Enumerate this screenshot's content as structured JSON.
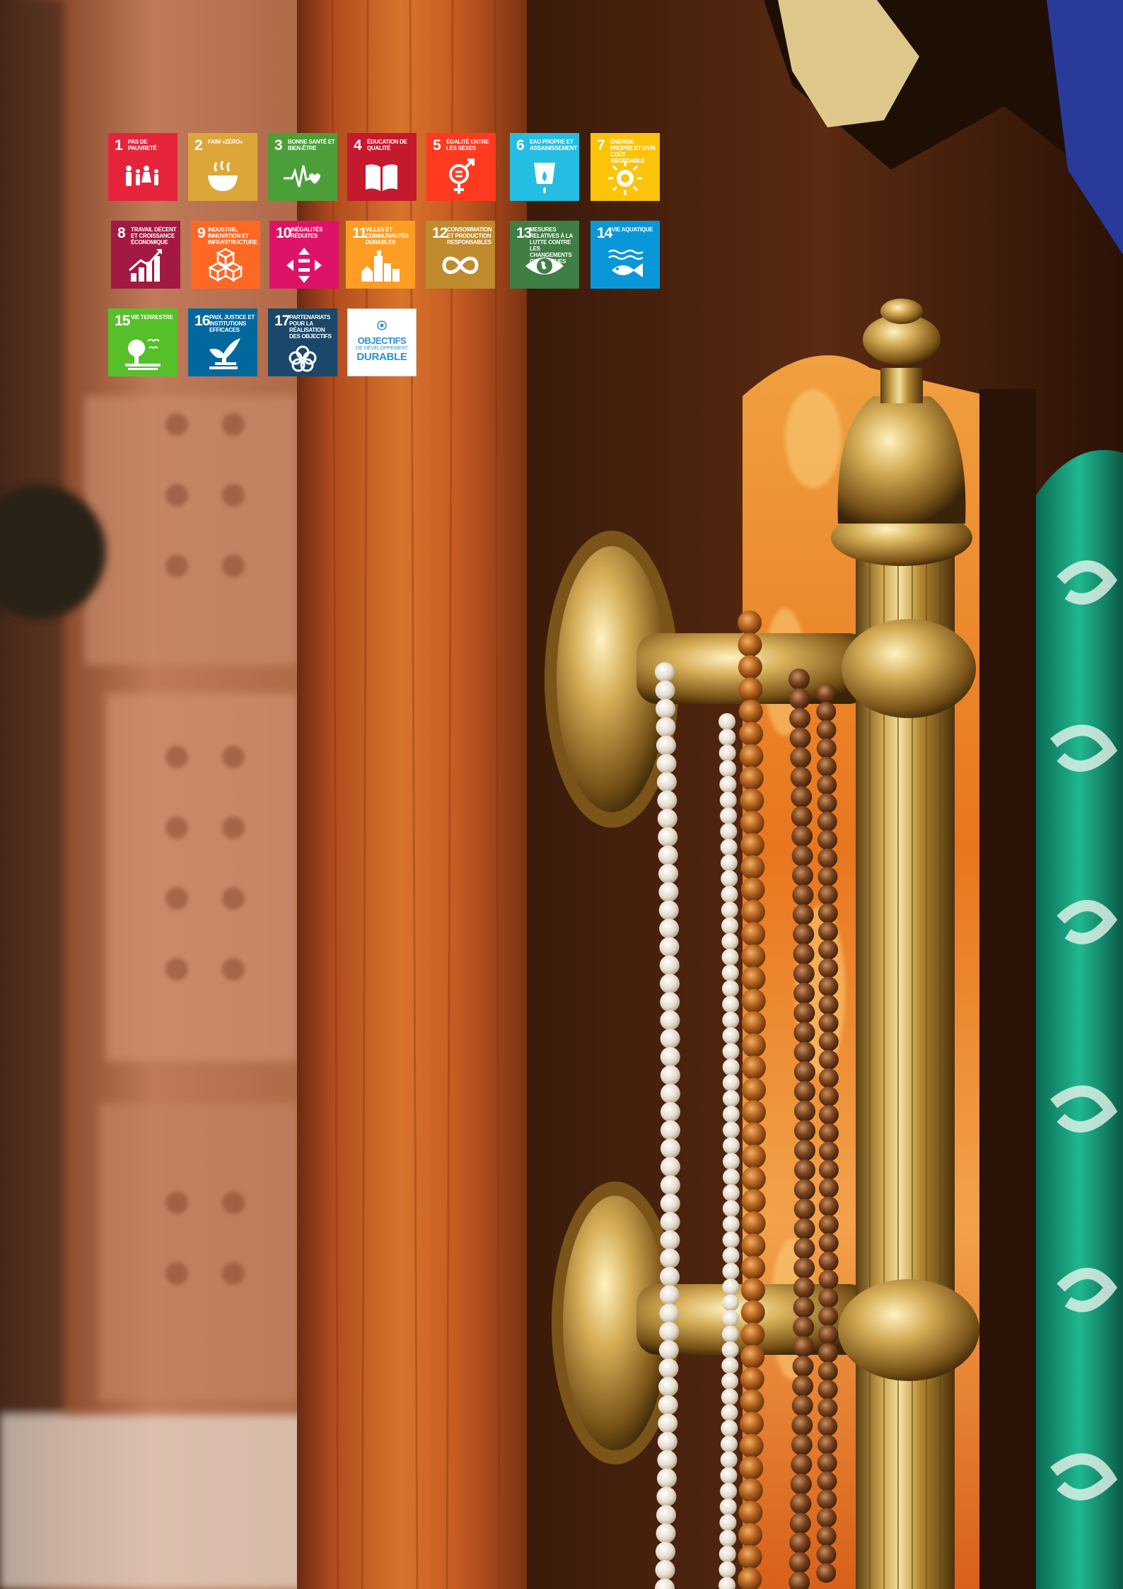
{
  "sdg_goals": [
    {
      "number": "1",
      "label": "PAS DE PAUVRETÉ",
      "color": "#e5243b",
      "icon": "family-icon"
    },
    {
      "number": "2",
      "label": "FAIM «ZÉRO»",
      "color": "#dda63a",
      "icon": "bowl-icon"
    },
    {
      "number": "3",
      "label": "BONNE SANTÉ ET BIEN-ÊTRE",
      "color": "#4c9f38",
      "icon": "heartbeat-icon"
    },
    {
      "number": "4",
      "label": "ÉDUCATION DE QUALITÉ",
      "color": "#c5192d",
      "icon": "book-icon"
    },
    {
      "number": "5",
      "label": "ÉGALITÉ ENTRE LES SEXES",
      "color": "#ff3a21",
      "icon": "gender-equality-icon"
    },
    {
      "number": "6",
      "label": "EAU PROPRE ET ASSAINISSEMENT",
      "color": "#26bde2",
      "icon": "water-drop-icon"
    },
    {
      "number": "7",
      "label": "ÉNERGIE PROPRE ET D'UN COÛT ABORDABLE",
      "color": "#fcc30b",
      "icon": "sun-power-icon"
    },
    {
      "number": "8",
      "label": "TRAVAIL DÉCENT ET CROISSANCE ÉCONOMIQUE",
      "color": "#a21942",
      "icon": "growth-chart-icon"
    },
    {
      "number": "9",
      "label": "INDUSTRIE, INNOVATION ET INFRASTRUCTURE",
      "color": "#fd6925",
      "icon": "cubes-icon"
    },
    {
      "number": "10",
      "label": "INÉGALITÉS RÉDUITES",
      "color": "#dd1367",
      "icon": "equality-arrows-icon"
    },
    {
      "number": "11",
      "label": "VILLES ET COMMUNAUTÉS DURABLES",
      "color": "#fd9d24",
      "icon": "city-icon"
    },
    {
      "number": "12",
      "label": "CONSOMMATION ET PRODUCTION RESPONSABLES",
      "color": "#bf8b2e",
      "icon": "infinity-icon"
    },
    {
      "number": "13",
      "label": "MESURES RELATIVES À LA LUTTE CONTRE LES CHANGEMENTS CLIMATIQUES",
      "color": "#3f7e44",
      "icon": "earth-eye-icon"
    },
    {
      "number": "14",
      "label": "VIE AQUATIQUE",
      "color": "#0a97d9",
      "icon": "fish-icon"
    },
    {
      "number": "15",
      "label": "VIE TERRESTRE",
      "color": "#56c02b",
      "icon": "tree-bird-icon"
    },
    {
      "number": "16",
      "label": "PAIX, JUSTICE ET INSTITUTIONS EFFICACES",
      "color": "#00689d",
      "icon": "dove-gavel-icon"
    },
    {
      "number": "17",
      "label": "PARTENARIATS POUR LA RÉALISATION DES OBJECTIFS",
      "color": "#19486a",
      "icon": "rings-icon"
    }
  ],
  "sdg_logo": {
    "line1": "OBJECTIFS",
    "line2": "DE DÉVELOPPEMENT",
    "line3": "DURABLE",
    "color": "#2f8fd0",
    "icon": "un-emblem-icon"
  },
  "photo": {
    "subject": "brass-door-handle-with-prayer-beads",
    "palette": [
      "#3a1c0c",
      "#b5582a",
      "#c9a24a",
      "#1a9a82",
      "#e8dfd0"
    ]
  }
}
